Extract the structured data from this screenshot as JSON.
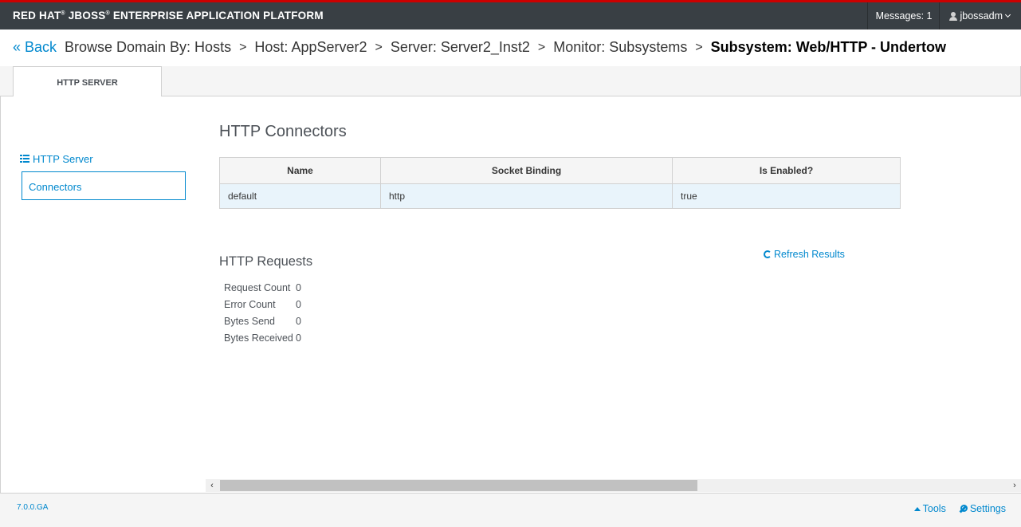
{
  "header": {
    "brand_redhat": "RED HAT",
    "brand_jboss": "JBOSS",
    "brand_rest": "ENTERPRISE APPLICATION PLATFORM",
    "messages_label": "Messages: 1",
    "user_label": "jbossadm"
  },
  "breadcrumb": {
    "back_label": "« Back",
    "items": [
      "Browse Domain By: Hosts",
      "Host: AppServer2",
      "Server: Server2_Inst2",
      "Monitor: Subsystems"
    ],
    "current": "Subsystem: Web/HTTP - Undertow",
    "separator": ">"
  },
  "tabs": [
    {
      "label": "HTTP SERVER",
      "active": true
    }
  ],
  "sidebar": {
    "heading": "HTTP Server",
    "items": [
      {
        "label": "Connectors",
        "selected": true
      }
    ]
  },
  "connectors": {
    "title": "HTTP Connectors",
    "columns": [
      "Name",
      "Socket Binding",
      "Is Enabled?"
    ],
    "rows": [
      [
        "default",
        "http",
        "true"
      ]
    ]
  },
  "requests": {
    "title": "HTTP Requests",
    "refresh_label": "Refresh Results",
    "stats": [
      {
        "label": "Request Count",
        "value": "0"
      },
      {
        "label": "Error Count",
        "value": "0"
      },
      {
        "label": "Bytes Send",
        "value": "0"
      },
      {
        "label": "Bytes Received",
        "value": "0"
      }
    ]
  },
  "footer": {
    "version": "7.0.0.GA",
    "tools_label": "Tools",
    "settings_label": "Settings"
  },
  "colors": {
    "header_bg": "#393f44",
    "header_accent": "#cc0000",
    "link": "#0088ce",
    "row_highlight": "#e9f4fb"
  },
  "icons": {
    "back": "double-chevron-left-icon",
    "user": "user-icon",
    "user_menu": "chevron-down-icon",
    "sidebar_heading": "list-icon",
    "refresh": "refresh-icon",
    "tools": "caret-up-icon",
    "settings": "wrench-icon"
  }
}
